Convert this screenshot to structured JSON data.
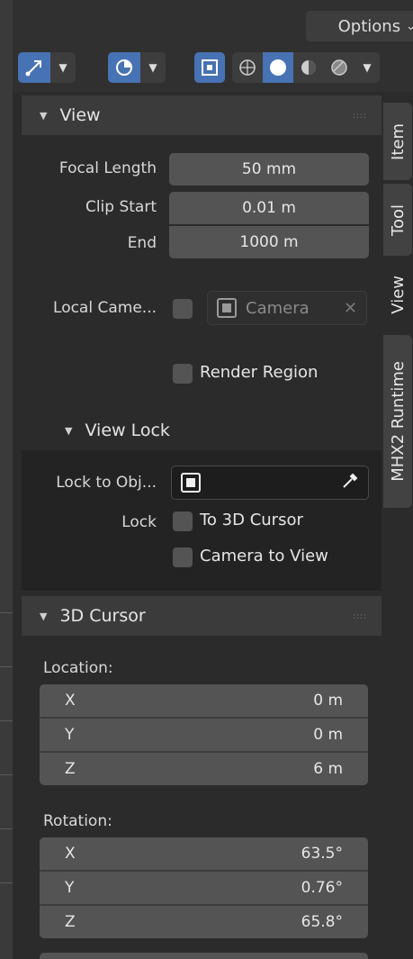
{
  "header": {
    "options_label": "Options",
    "icons": [
      "gizmo-icon",
      "overlay-icon",
      "xray-icon",
      "wireframe-shading-icon",
      "solid-shading-icon",
      "material-shading-icon",
      "rendered-shading-icon"
    ]
  },
  "tabs": [
    "Item",
    "Tool",
    "View",
    "MHX2 Runtime"
  ],
  "view_panel": {
    "title": "View",
    "focal_length_label": "Focal Length",
    "focal_length_value": "50 mm",
    "clip_start_label": "Clip Start",
    "clip_start_value": "0.01 m",
    "end_label": "End",
    "end_value": "1000 m",
    "local_camera_label": "Local Came...",
    "local_camera_placeholder": "Camera",
    "render_region_label": "Render Region",
    "view_lock": {
      "title": "View Lock",
      "lock_to_object_label": "Lock to Obj...",
      "lock_label": "Lock",
      "to_3d_cursor_label": "To 3D Cursor",
      "camera_to_view_label": "Camera to View"
    }
  },
  "cursor_panel": {
    "title": "3D Cursor",
    "location_label": "Location:",
    "location": [
      {
        "axis": "X",
        "value": "0 m"
      },
      {
        "axis": "Y",
        "value": "0 m"
      },
      {
        "axis": "Z",
        "value": "6 m"
      }
    ],
    "rotation_label": "Rotation:",
    "rotation": [
      {
        "axis": "X",
        "value": "63.5°"
      },
      {
        "axis": "Y",
        "value": "0.76°"
      },
      {
        "axis": "Z",
        "value": "65.8°"
      }
    ]
  },
  "colors": {
    "accent": "#4772b3",
    "field": "#545454",
    "panel_header": "#3b3b3b",
    "background": "#2b2b2b"
  }
}
